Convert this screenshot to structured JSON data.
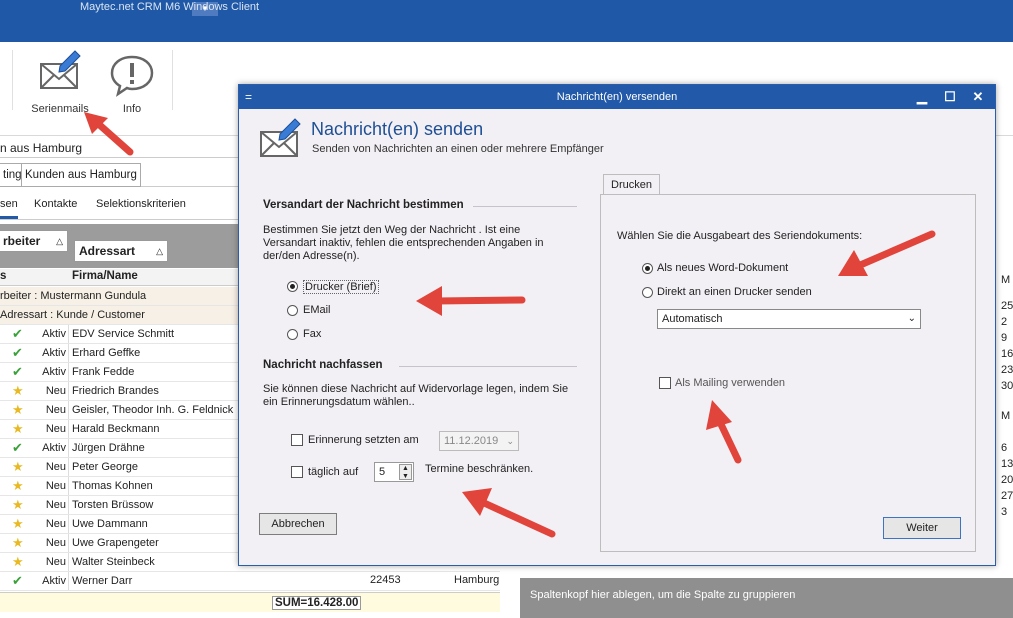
{
  "app": {
    "title": "Maytec.net CRM M6 Windows Client",
    "ribbon": {
      "serienmails_label": "Serienmails",
      "info_label": "Info"
    },
    "crumb": "n aus Hamburg",
    "tabs": [
      "ting",
      "Kunden aus Hamburg"
    ],
    "subtabs": [
      "sen",
      "Kontakte",
      "Selektionskriterien"
    ],
    "group_chips": [
      "rbeiter",
      "Adressart"
    ],
    "columns": {
      "status": "s",
      "firma": "Firma/Name"
    },
    "groups": [
      "rbeiter : Mustermann Gundula",
      "Adressart : Kunde / Customer"
    ],
    "rows": [
      {
        "icon": "check",
        "status": "Aktiv",
        "name": "EDV Service Schmitt"
      },
      {
        "icon": "check",
        "status": "Aktiv",
        "name": "Erhard Geffke"
      },
      {
        "icon": "check",
        "status": "Aktiv",
        "name": "Frank Fedde"
      },
      {
        "icon": "star",
        "status": "Neu",
        "name": "Friedrich Brandes"
      },
      {
        "icon": "star",
        "status": "Neu",
        "name": "Geisler, Theodor Inh. G. Feldnick"
      },
      {
        "icon": "star",
        "status": "Neu",
        "name": "Harald Beckmann"
      },
      {
        "icon": "check",
        "status": "Aktiv",
        "name": "Jürgen Drähne"
      },
      {
        "icon": "star",
        "status": "Neu",
        "name": "Peter George"
      },
      {
        "icon": "star",
        "status": "Neu",
        "name": "Thomas Kohnen"
      },
      {
        "icon": "star",
        "status": "Neu",
        "name": "Torsten Brüssow"
      },
      {
        "icon": "star",
        "status": "Neu",
        "name": "Uwe Dammann"
      },
      {
        "icon": "star",
        "status": "Neu",
        "name": "Uwe Grapengeter"
      },
      {
        "icon": "star",
        "status": "Neu",
        "name": "Walter Steinbeck"
      },
      {
        "icon": "check",
        "status": "Aktiv",
        "name": "Werner Darr"
      }
    ],
    "last_row_extra": {
      "plz": "22453",
      "ort": "Hamburg"
    },
    "sum": "SUM=16.428.00",
    "group_hint": "Spaltenkopf hier ablegen, um die Spalte zu gruppieren",
    "right_edge": [
      "M",
      "25",
      "2",
      "9",
      "16",
      "23",
      "30",
      "M",
      "6",
      "13",
      "20",
      "27",
      "3"
    ]
  },
  "dialog": {
    "title": "Nachricht(en) versenden",
    "heading": "Nachricht(en) senden",
    "subheading": "Senden von Nachrichten an einen oder mehrere Empfänger",
    "section1": {
      "title": "Versandart der Nachricht bestimmen",
      "text": "Bestimmen Sie jetzt den Weg der Nachricht . Ist eine Versandart inaktiv, fehlen die entsprechenden Angaben in der/den Adresse(n).",
      "options": [
        "Drucker (Brief)",
        "EMail",
        "Fax"
      ],
      "selected": "Drucker (Brief)"
    },
    "section2": {
      "title": "Nachricht nachfassen",
      "text": "Sie können diese Nachricht auf Widervorlage legen, indem Sie ein Erinnerungsdatum wählen..",
      "reminder_label": "Erinnerung setzten am",
      "reminder_date": "11.12.2019",
      "daily_label": "täglich auf",
      "daily_value": "5",
      "daily_suffix": "Termine beschränken."
    },
    "cancel_label": "Abbrechen",
    "next_label": "Weiter",
    "tab": {
      "label": "Drucken",
      "prompt": "Wählen Sie die Ausgabeart des Seriendokuments:",
      "options": [
        "Als neues Word-Dokument",
        "Direkt an einen Drucker senden"
      ],
      "selected": "Als neues Word-Dokument",
      "printer_select": "Automatisch",
      "mailing_label": "Als Mailing verwenden"
    }
  },
  "colors": {
    "titlebar": "#1e58a7",
    "dialog_title": "#2259a8",
    "heading": "#1e4f95",
    "arrow": "#e0443a"
  }
}
